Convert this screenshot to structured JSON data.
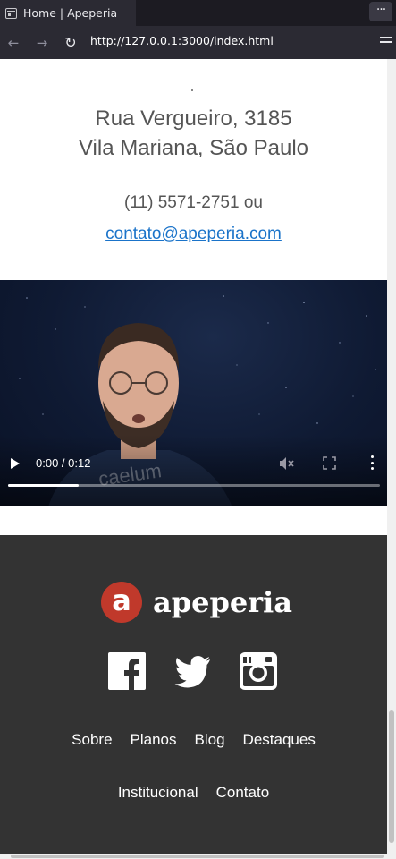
{
  "browser": {
    "tab_title": "Home | Apeperia",
    "url": "http://127.0.0.1:3000/index.html"
  },
  "contact": {
    "address_line1": "Rua Vergueiro, 3185",
    "address_line2": "Vila Mariana, São Paulo",
    "phone": "(11) 5571-2751 ou",
    "email": "contato@apeperia.com"
  },
  "video": {
    "time": "0:00 / 0:12",
    "progress_fraction": 0.19,
    "watermark": "caelum"
  },
  "footer": {
    "logo_letter": "a",
    "logo_text": "apeperia",
    "social": [
      "facebook-icon",
      "twitter-icon",
      "instagram-icon"
    ],
    "menu_row1": [
      "Sobre",
      "Planos",
      "Blog",
      "Destaques"
    ],
    "menu_row2": [
      "Institucional",
      "Contato"
    ]
  },
  "colors": {
    "footer_bg": "#333333",
    "brand_red": "#c0392b",
    "link_blue": "#1a73c9"
  }
}
